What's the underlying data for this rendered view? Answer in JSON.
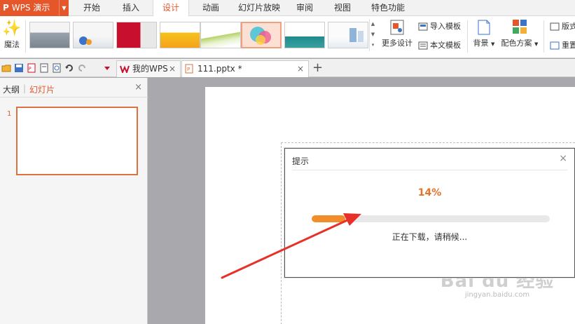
{
  "app": {
    "name": "WPS 演示",
    "logo": "P"
  },
  "menu": {
    "tabs": [
      {
        "label": "开始"
      },
      {
        "label": "插入"
      },
      {
        "label": "设计"
      },
      {
        "label": "动画"
      },
      {
        "label": "幻灯片放映"
      },
      {
        "label": "审阅"
      },
      {
        "label": "视图"
      },
      {
        "label": "特色功能"
      }
    ],
    "active_tab": "设计"
  },
  "ribbon": {
    "magic_label": "魔法",
    "more_design": "更多设计",
    "import_template": "导入模板",
    "text_template": "本文模板",
    "background": "背景",
    "color_scheme": "配色方案",
    "layout_partial": "版式",
    "reset_partial": "重置"
  },
  "doc_tabs": [
    {
      "label": "我的WPS",
      "close": "×"
    },
    {
      "label": "111.pptx *",
      "close": "×"
    }
  ],
  "new_tab": "+",
  "left_panel": {
    "tab_outline": "大纲",
    "tab_slides": "幻灯片",
    "close": "×",
    "slide_number": "1"
  },
  "dialog": {
    "title": "提示",
    "close": "×",
    "percent": "14%",
    "progress": 0.14,
    "status": "正在下载，请稍候..."
  },
  "watermark": {
    "logo": "Bai du 经验",
    "url": "jingyan.baidu.com"
  },
  "colors": {
    "accent": "#e5562b",
    "progress_fill": "#f28d2b",
    "annotation_arrow": "#e8302a"
  }
}
